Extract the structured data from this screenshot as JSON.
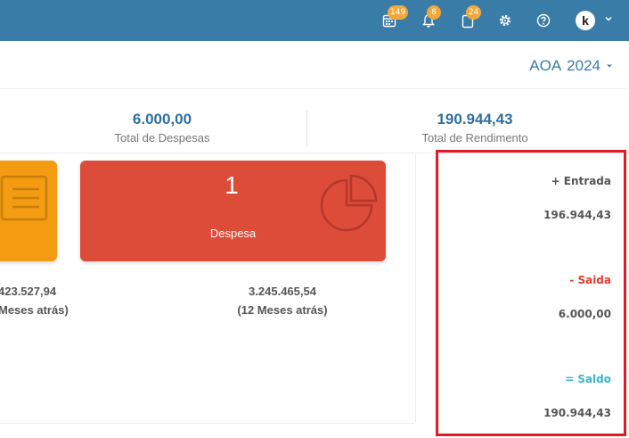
{
  "topbar": {
    "badges": {
      "calendar": "149",
      "bell": "8",
      "clipboard": "24"
    },
    "avatar_letter": "k"
  },
  "subheader": {
    "currency": "AOA",
    "year": "2024"
  },
  "stats": [
    {
      "value": "6.000,00",
      "label": "Total de Despesas"
    },
    {
      "value": "190.944,43",
      "label": "Total de Rendimento"
    }
  ],
  "cards": {
    "expense_count": "1",
    "expense_label": "Despesa"
  },
  "history": {
    "left_value": "423.527,94",
    "left_label": "Meses atrás)",
    "right_value": "3.245.465,54",
    "right_label": "(12 Meses atrás)"
  },
  "summary": {
    "entrada_label": "+ Entrada",
    "entrada_value": "196.944,43",
    "saida_label": "- Saida",
    "saida_value": "6.000,00",
    "saldo_label": "= Saldo",
    "saldo_value": "190.944,43"
  },
  "colors": {
    "topbar": "#3a7ca8",
    "red_card": "#dd4b39",
    "yellow_card": "#f39c12",
    "saida": "#e23b2e",
    "saldo": "#3bb4c8"
  }
}
